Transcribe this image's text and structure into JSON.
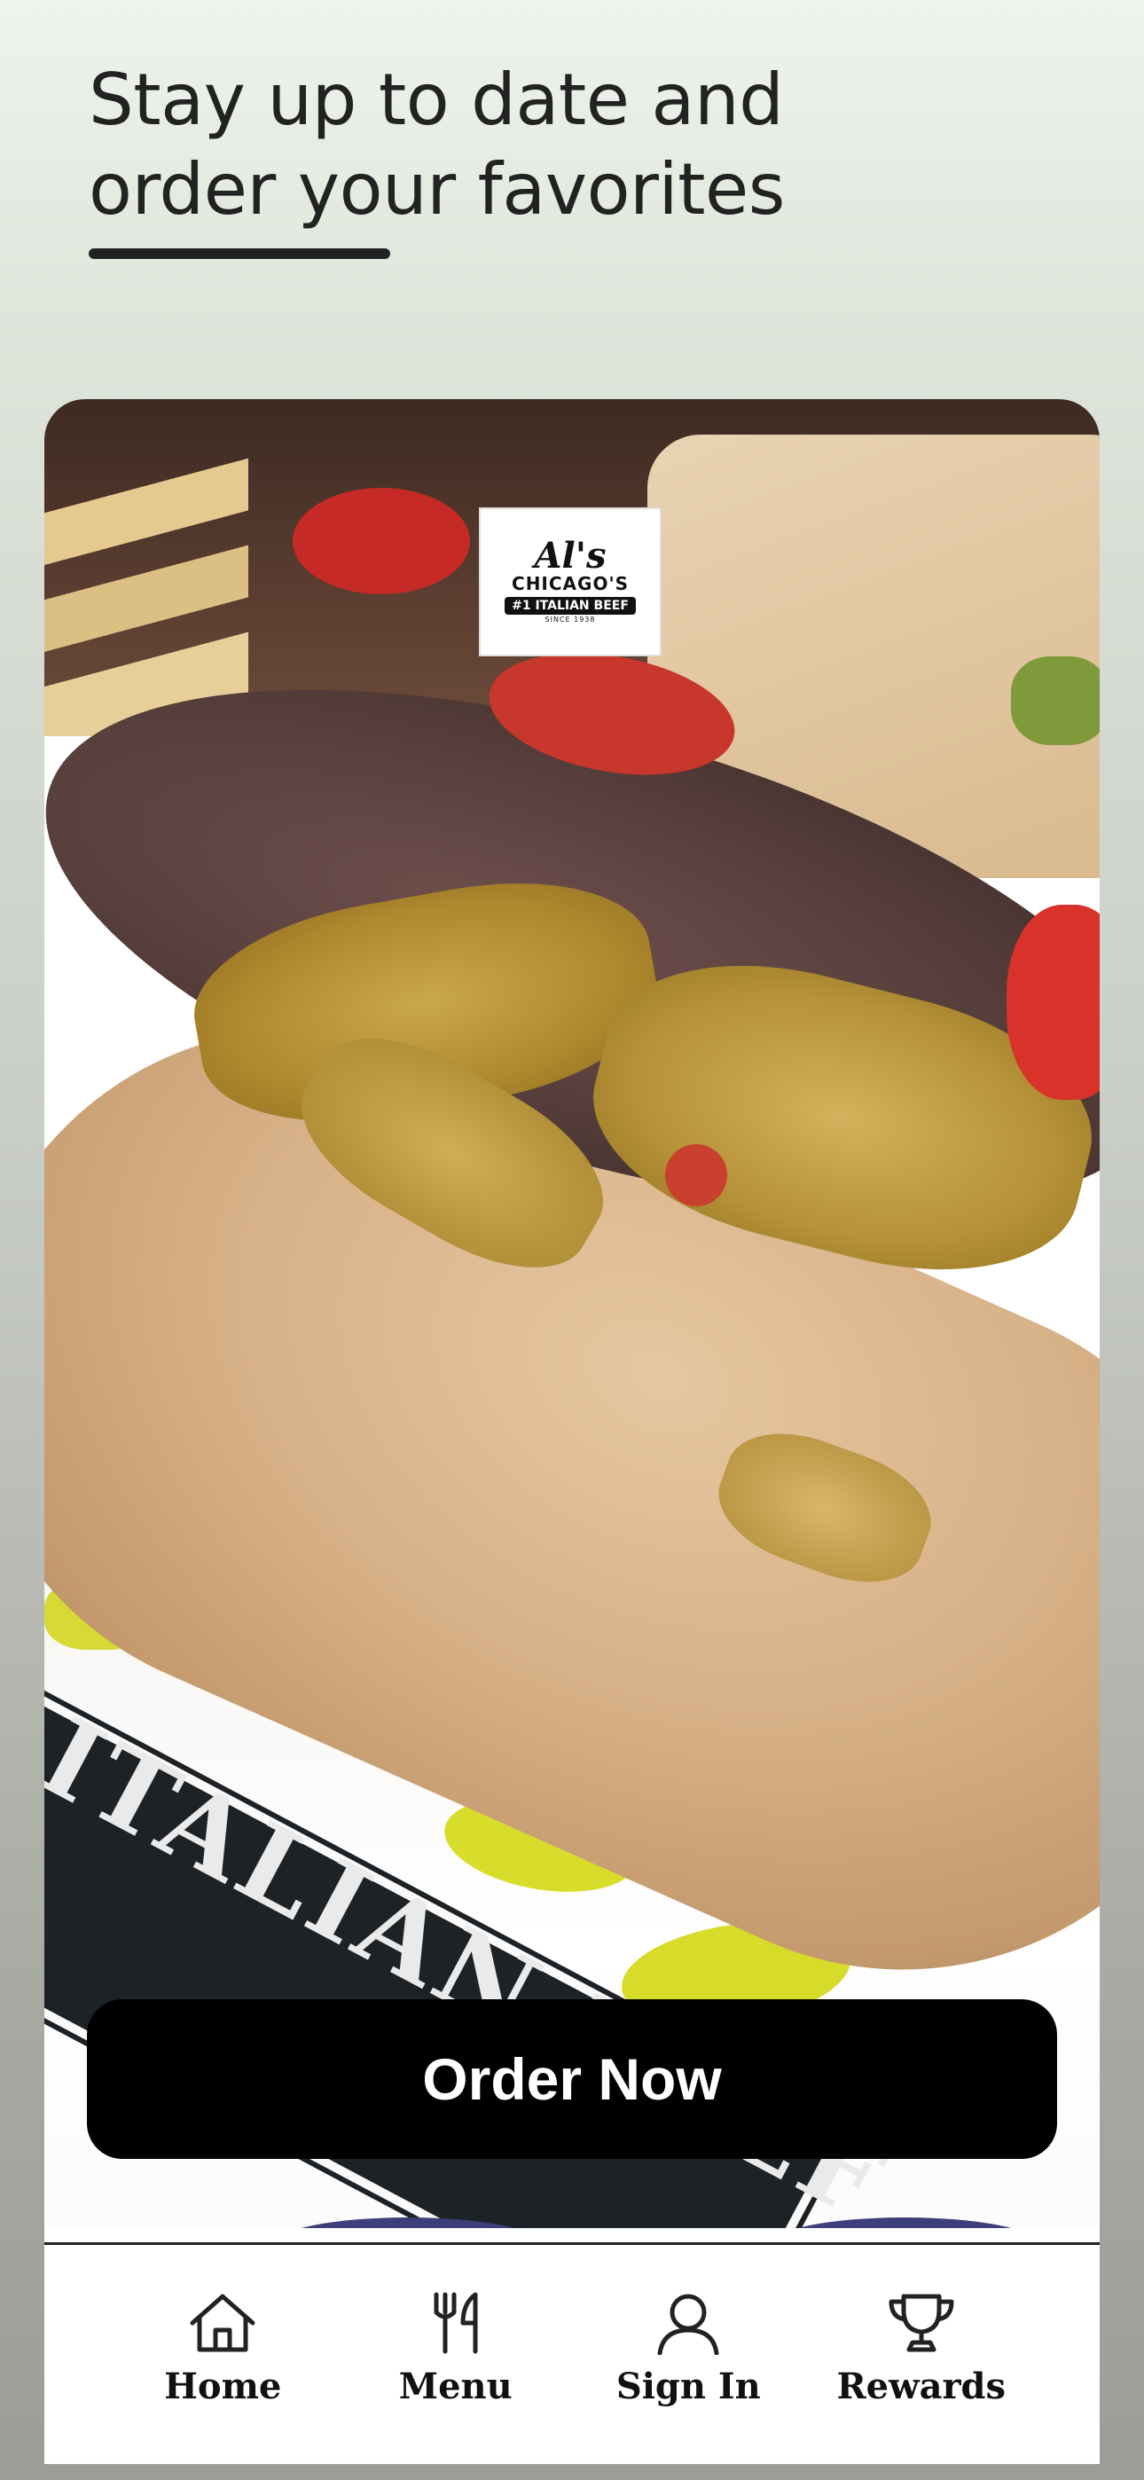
{
  "header": {
    "headline_line1": "Stay up to date and",
    "headline_line2": "order your favorites"
  },
  "hero": {
    "logo": {
      "script": "Al's",
      "name": "CHICAGO'S",
      "tagline": "#1 ITALIAN BEEF",
      "since": "SINCE 1938"
    },
    "wrapper_text": "ITALIAN BEEF",
    "order_button_label": "Order Now",
    "order_button_color": "#000000"
  },
  "tabbar": {
    "items": [
      {
        "label": "Home",
        "icon": "home-icon"
      },
      {
        "label": "Menu",
        "icon": "fork-knife-icon"
      },
      {
        "label": "Sign In",
        "icon": "user-icon"
      },
      {
        "label": "Rewards",
        "icon": "trophy-icon"
      }
    ]
  }
}
